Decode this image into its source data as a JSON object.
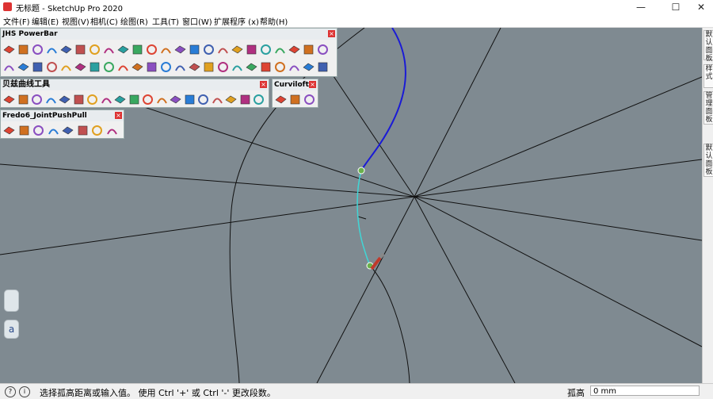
{
  "window": {
    "title": "无标题 - SketchUp Pro 2020",
    "minimize": "—",
    "maximize": "☐",
    "close": "✕"
  },
  "menu": [
    "文件(F)",
    "编辑(E)",
    "视图(V)",
    "相机(C)",
    "绘图(R)",
    "工具(T)",
    "窗口(W)",
    "扩展程序 (x)",
    "帮助(H)"
  ],
  "right_tabs": [
    "默认面板",
    "样式",
    "管理面板",
    "默认面板"
  ],
  "panels": {
    "jhs": {
      "title": "JHS PowerBar"
    },
    "bezier": {
      "title": "贝兹曲线工具"
    },
    "curviloft": {
      "title": "Curviloft"
    },
    "fredo": {
      "title": "Fredo6_JointPushPull"
    }
  },
  "side": {
    "a_label": "a"
  },
  "status": {
    "message": "选择孤高距离或输入值。 使用 Ctrl '+' 或 Ctrl '-' 更改段数。",
    "vcb_label": "孤高",
    "vcb_value": "0 mm"
  },
  "colors": {
    "viewport": "#7f8a91",
    "accent_blue": "#1a1ad6",
    "accent_cyan": "#40d6d6",
    "edge": "#000000"
  }
}
